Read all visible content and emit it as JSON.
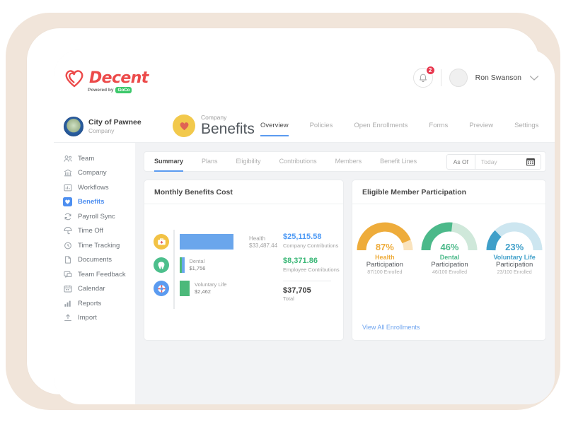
{
  "brand": {
    "name": "Decent",
    "powered_by": "Powered by",
    "partner": "GoCo",
    "logo_color": "#ec4a4a",
    "partner_color": "#3cc86a"
  },
  "topbar": {
    "notification_count": "2",
    "user_name": "Ron Swanson",
    "bell_icon": "bell-icon",
    "chevron_icon": "chevron-down-icon"
  },
  "company_header": {
    "company_name": "City of Pawnee",
    "company_sub": "Company",
    "title_eyebrow": "Company",
    "title": "Benefits",
    "tabs": [
      {
        "label": "Overview",
        "active": true
      },
      {
        "label": "Policies",
        "active": false
      },
      {
        "label": "Open Enrollments",
        "active": false
      },
      {
        "label": "Forms",
        "active": false
      },
      {
        "label": "Preview",
        "active": false
      },
      {
        "label": "Settings",
        "active": false
      }
    ]
  },
  "sidebar": {
    "items": [
      {
        "label": "Team",
        "icon": "people-icon",
        "active": false
      },
      {
        "label": "Company",
        "icon": "bank-icon",
        "active": false
      },
      {
        "label": "Workflows",
        "icon": "workflow-icon",
        "active": false
      },
      {
        "label": "Benefits",
        "icon": "benefits-icon",
        "active": true
      },
      {
        "label": "Payroll Sync",
        "icon": "sync-icon",
        "active": false
      },
      {
        "label": "Time Off",
        "icon": "umbrella-icon",
        "active": false
      },
      {
        "label": "Time Tracking",
        "icon": "clock-icon",
        "active": false
      },
      {
        "label": "Documents",
        "icon": "document-icon",
        "active": false
      },
      {
        "label": "Team Feedback",
        "icon": "feedback-icon",
        "active": false
      },
      {
        "label": "Calendar",
        "icon": "calendar-icon",
        "active": false
      },
      {
        "label": "Reports",
        "icon": "chart-bars-icon",
        "active": false
      },
      {
        "label": "Import",
        "icon": "upload-icon",
        "active": false
      }
    ]
  },
  "subtabs": {
    "items": [
      {
        "label": "Summary",
        "active": true
      },
      {
        "label": "Plans",
        "active": false
      },
      {
        "label": "Eligibility",
        "active": false
      },
      {
        "label": "Contributions",
        "active": false
      },
      {
        "label": "Members",
        "active": false
      },
      {
        "label": "Benefit Lines",
        "active": false
      }
    ],
    "as_of_label": "As Of",
    "as_of_placeholder": "Today",
    "as_of_value": "",
    "calendar_icon": "calendar-icon"
  },
  "cost_card": {
    "title": "Monthly Benefits Cost",
    "company_amount": "$25,115.58",
    "company_label": "Company Contributions",
    "company_color": "#4e9af5",
    "employee_amount": "$8,371.86",
    "employee_label": "Employee Contributions",
    "employee_color": "#3cb878",
    "total_amount": "$37,705",
    "total_label": "Total",
    "highlight": {
      "name": "Health",
      "value": "$33,487.44"
    }
  },
  "participation_card": {
    "title": "Eligible Member Participation",
    "view_all_label": "View All Enrollments"
  },
  "chart_data": [
    {
      "type": "bar",
      "title": "Monthly Benefits Cost",
      "orientation": "horizontal",
      "categories": [
        "Health",
        "Dental",
        "Voluntary Life"
      ],
      "values": [
        33487.44,
        1756,
        2462
      ],
      "value_labels": [
        "$33,487.44",
        "$1,756",
        "$2,462"
      ],
      "bar_colors": [
        "#6aa6ec",
        "#6aa6ec",
        "#4cb97a"
      ],
      "icon_colors": [
        "#f2c245",
        "#4cbf8c",
        "#5b9bf0"
      ],
      "icons": [
        "medkit-icon",
        "tooth-icon",
        "life-ring-icon"
      ],
      "xlabel": "",
      "ylabel": "",
      "grid": false
    },
    {
      "type": "pie",
      "subtype": "gauge",
      "title": "Eligible Member Participation",
      "categories": [
        "Health",
        "Dental",
        "Voluntary Life"
      ],
      "values": [
        87,
        46,
        23
      ],
      "value_labels": [
        "87%",
        "46%",
        "23%"
      ],
      "sub_labels": [
        "Participation",
        "Participation",
        "Participation"
      ],
      "detail_labels": [
        "87/100 Enrolled",
        "46/100 Enrolled",
        "23/100 Enrolled"
      ],
      "enrolled": [
        87,
        46,
        23
      ],
      "eligible": [
        100,
        100,
        100
      ],
      "colors": [
        "#eeac3b",
        "#4cb98a",
        "#3f9fc9"
      ],
      "track_colors": [
        "#fae3bd",
        "#cfe8da",
        "#cde6f0"
      ],
      "ylim": [
        0,
        100
      ],
      "legend": "none"
    }
  ]
}
